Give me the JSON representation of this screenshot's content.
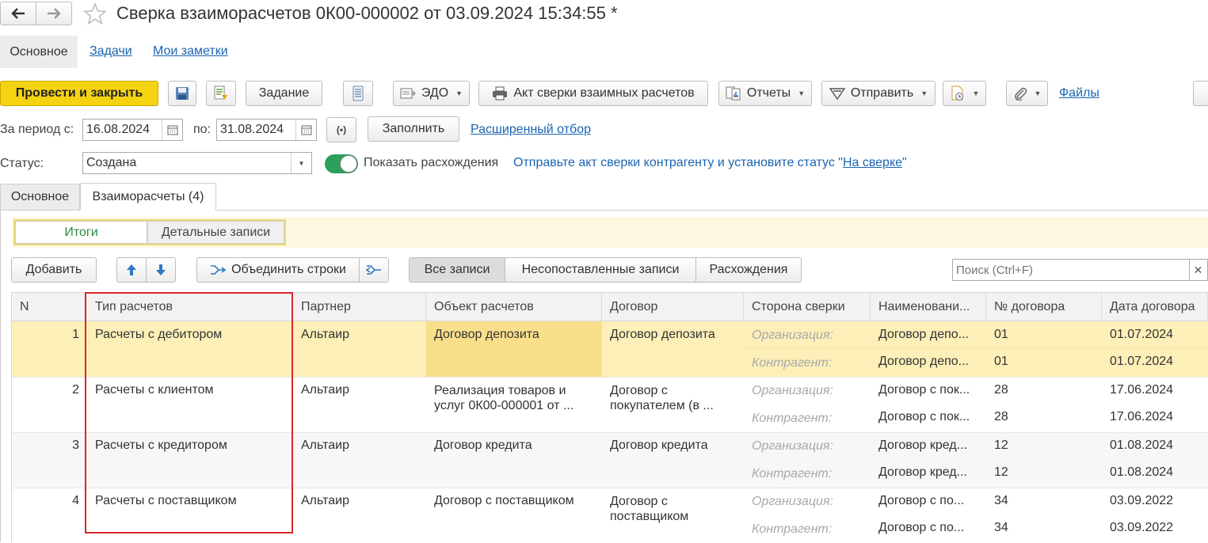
{
  "window": {
    "title": "Сверка взаиморасчетов 0К00-000002 от 03.09.2024 15:34:55 *"
  },
  "nav_tabs": [
    "Основное",
    "Задачи",
    "Мои заметки"
  ],
  "toolbar": {
    "post_close": "Провести и закрыть",
    "task": "Задание",
    "edo": "ЭДО",
    "act": "Акт сверки взаимных расчетов",
    "reports": "Отчеты",
    "send": "Отправить",
    "files": "Файлы"
  },
  "period": {
    "label_from": "За период с:",
    "from": "16.08.2024",
    "label_to": "по:",
    "to": "31.08.2024",
    "fill": "Заполнить",
    "advanced_filter": "Расширенный отбор"
  },
  "status": {
    "label": "Статус:",
    "value": "Создана",
    "toggle_label": "Показать расхождения",
    "toggle_on": true,
    "hint_prefix": "Отправьте акт сверки контрагенту и установите статус \"",
    "hint_link": "На сверке",
    "hint_suffix": "\""
  },
  "content_tabs": [
    "Основное",
    "Взаиморасчеты (4)"
  ],
  "view_switch": [
    "Итоги",
    "Детальные записи"
  ],
  "table_toolbar": {
    "add": "Добавить",
    "merge": "Объединить строки",
    "filters": [
      "Все записи",
      "Несопоставленные записи",
      "Расхождения"
    ],
    "search_placeholder": "Поиск (Ctrl+F)"
  },
  "table": {
    "headers": [
      "N",
      "Тип расчетов",
      "Партнер",
      "Объект расчетов",
      "Договор",
      "Сторона сверки",
      "Наименовани...",
      "№ договора",
      "Дата договора"
    ],
    "rows": [
      {
        "n": "1",
        "type": "Расчеты с дебитором",
        "partner": "Альтаир",
        "object": "Договор депозита",
        "contract": "Договор депозита",
        "side1": "Организация:",
        "name1": "Договор депо...",
        "num1": "01",
        "date1": "01.07.2024",
        "side2": "Контрагент:",
        "name2": "Договор депо...",
        "num2": "01",
        "date2": "01.07.2024"
      },
      {
        "n": "2",
        "type": "Расчеты с клиентом",
        "partner": "Альтаир",
        "object": "Реализация товаров и услуг 0К00-000001 от ...",
        "contract": "Договор с покупателем (в ...",
        "side1": "Организация:",
        "name1": "Договор с пок...",
        "num1": "28",
        "date1": "17.06.2024",
        "side2": "Контрагент:",
        "name2": "Договор с пок...",
        "num2": "28",
        "date2": "17.06.2024"
      },
      {
        "n": "3",
        "type": "Расчеты с кредитором",
        "partner": "Альтаир",
        "object": "Договор кредита",
        "contract": "Договор кредита",
        "side1": "Организация:",
        "name1": "Договор кред...",
        "num1": "12",
        "date1": "01.08.2024",
        "side2": "Контрагент:",
        "name2": "Договор кред...",
        "num2": "12",
        "date2": "01.08.2024"
      },
      {
        "n": "4",
        "type": "Расчеты с поставщиком",
        "partner": "Альтаир",
        "object": "Договор с поставщиком",
        "contract": "Договор с поставщиком",
        "side1": "Организация:",
        "name1": "Договор с по...",
        "num1": "34",
        "date1": "03.09.2022",
        "side2": "Контрагент:",
        "name2": "Договор с по...",
        "num2": "34",
        "date2": "03.09.2022"
      }
    ]
  },
  "colors": {
    "primary_button": "#f5d313",
    "selected_row": "#fcefb8",
    "selected_cell": "#f9df8a",
    "highlight_frame": "#d9262c",
    "link": "#1a64b0",
    "toggle": "#2aa05a"
  },
  "icons": [
    "back-arrow-icon",
    "forward-arrow-icon",
    "star-icon",
    "save-icon",
    "structure-icon",
    "list-icon",
    "edo-icon",
    "printer-icon",
    "reports-icon",
    "send-icon",
    "attach-doc-icon",
    "paperclip-icon",
    "calendar-icon",
    "period-select-icon",
    "arrow-up-icon",
    "arrow-down-icon",
    "merge-icon",
    "split-icon",
    "close-icon"
  ]
}
